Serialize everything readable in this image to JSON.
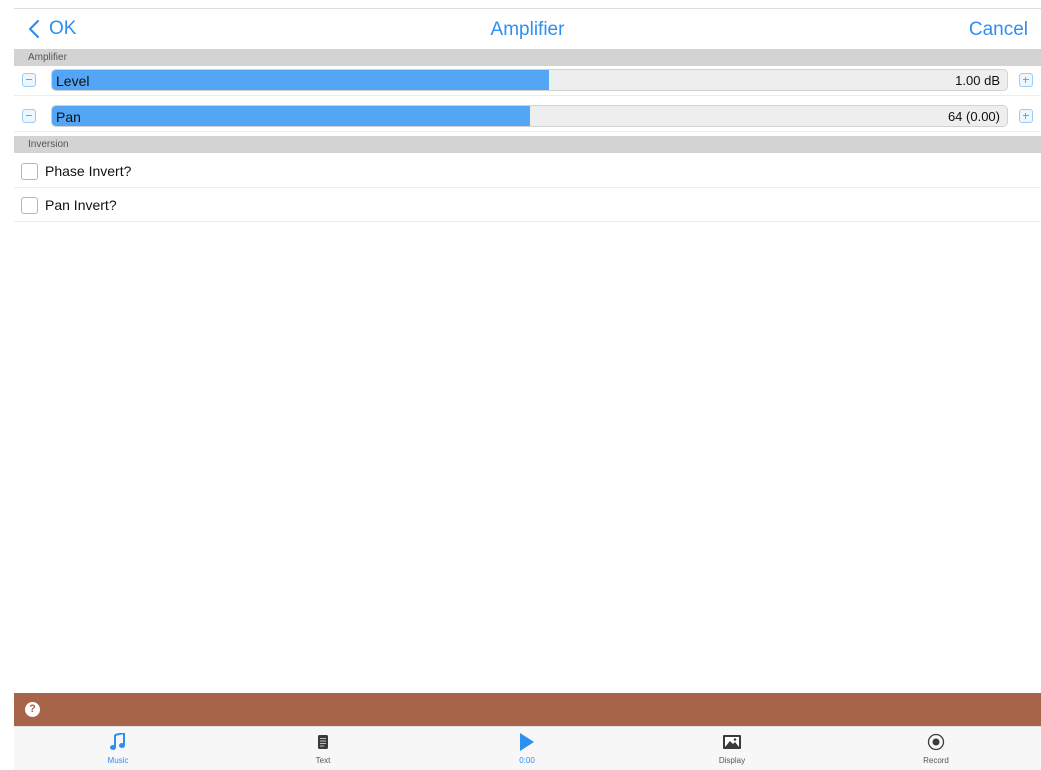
{
  "nav": {
    "ok_label": "OK",
    "title": "Amplifier",
    "cancel_label": "Cancel"
  },
  "sections": {
    "amplifier": "Amplifier",
    "inversion": "Inversion"
  },
  "sliders": {
    "level": {
      "label": "Level",
      "value": "1.00 dB",
      "fraction": 0.52
    },
    "pan": {
      "label": "Pan",
      "value": "64 (0.00)",
      "fraction": 0.5
    }
  },
  "checkboxes": {
    "phase_invert": {
      "label": "Phase Invert?",
      "checked": false
    },
    "pan_invert": {
      "label": "Pan Invert?",
      "checked": false
    }
  },
  "help": {
    "icon": "question-icon",
    "glyph": "?"
  },
  "tabs": {
    "music": {
      "label": "Music",
      "icon": "music-note-icon",
      "active": true
    },
    "text": {
      "label": "Text",
      "icon": "document-icon",
      "active": false
    },
    "play": {
      "label": "0:00",
      "icon": "play-icon",
      "active": true
    },
    "display": {
      "label": "Display",
      "icon": "image-icon",
      "active": false
    },
    "record": {
      "label": "Record",
      "icon": "record-icon",
      "active": false
    }
  },
  "colors": {
    "accent": "#2f8ff0",
    "slider_fill": "#52a6f5",
    "help_bar": "#a76448",
    "section_header": "#d3d3d3"
  }
}
